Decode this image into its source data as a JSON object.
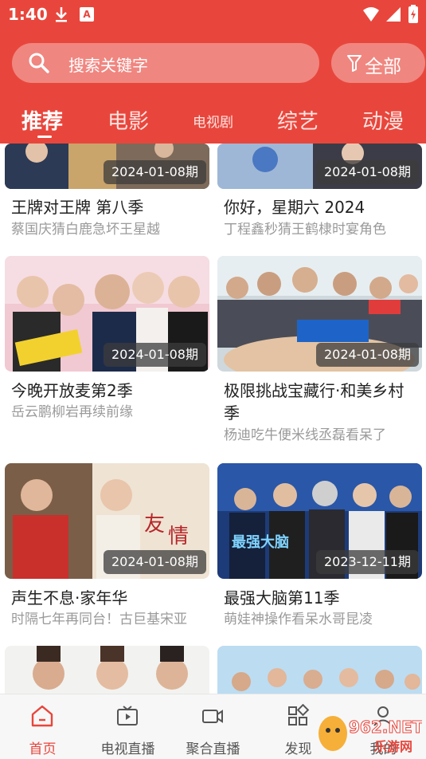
{
  "status_bar": {
    "time": "1:40"
  },
  "search": {
    "placeholder": "搜索关键字",
    "filter_label": "全部"
  },
  "tabs": [
    {
      "label": "推荐",
      "active": true
    },
    {
      "label": "电影",
      "active": false
    },
    {
      "label": "电视剧",
      "active": false
    },
    {
      "label": "综艺",
      "active": false
    },
    {
      "label": "动漫",
      "active": false
    }
  ],
  "cards": [
    {
      "title": "王牌对王牌 第八季",
      "subtitle": "蔡国庆猜白鹿急坏王星越",
      "date": "2024-01-08期"
    },
    {
      "title": "你好，星期六 2024",
      "subtitle": "丁程鑫秒猜王鹤棣时宴角色",
      "date": "2024-01-08期"
    },
    {
      "title": "今晚开放麦第2季",
      "subtitle": "岳云鹏柳岩再续前缘",
      "date": "2024-01-08期"
    },
    {
      "title_line1": "极限挑战宝藏行·和美乡村",
      "title_line2": "季",
      "subtitle": "杨迪吃牛便米线丞磊看呆了",
      "date": "2024-01-08期"
    },
    {
      "title": "声生不息·家年华",
      "subtitle": "时隔七年再同台！古巨基宋亚",
      "date": "2024-01-08期"
    },
    {
      "title": "最强大脑第11季",
      "subtitle": "萌娃神操作看呆水哥昆凌",
      "date": "2023-12-11期"
    }
  ],
  "bottom_nav": [
    {
      "label": "首页",
      "icon": "home-icon",
      "active": true
    },
    {
      "label": "电视直播",
      "icon": "tv-icon",
      "active": false
    },
    {
      "label": "聚合直播",
      "icon": "video-camera-icon",
      "active": false
    },
    {
      "label": "发现",
      "icon": "grid-icon",
      "active": false
    },
    {
      "label": "我的",
      "icon": "user-icon",
      "active": false
    }
  ],
  "watermark": {
    "text": "962.NET",
    "sub": "乐游网"
  },
  "colors": {
    "accent": "#e8463c",
    "muted_text": "#9a9a9a",
    "nav_text": "#555555"
  }
}
